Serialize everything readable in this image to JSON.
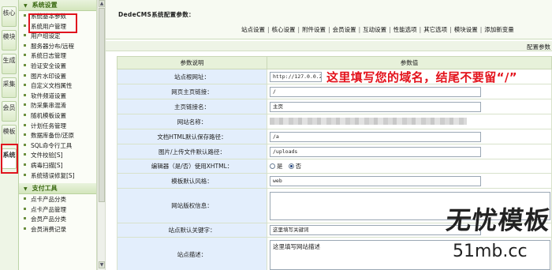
{
  "vertical_tabs": [
    {
      "label": "核心",
      "active": false
    },
    {
      "label": "模块",
      "active": false
    },
    {
      "label": "生成",
      "active": false
    },
    {
      "label": "采集",
      "active": false
    },
    {
      "label": "会员",
      "active": false
    },
    {
      "label": "模板",
      "active": false
    },
    {
      "label": "系统",
      "active": true
    }
  ],
  "menu": {
    "system_section": "系统设置",
    "system_items": [
      "系统基本参数",
      "系统用户管理",
      "用户组设定",
      "服务器分布/远程",
      "系统日志管理",
      "验证安全设置",
      "图片水印设置",
      "自定义文档属性",
      "软件频道设置",
      "防采集串混淆",
      "随机模板设置",
      "计划任务管理",
      "数据库备份/还原",
      "SQL命令行工具",
      "文件校验[S]",
      "病毒扫描[S]",
      "系统错误修复[S]"
    ],
    "pay_section": "支付工具",
    "pay_items": [
      "点卡产品分类",
      "点卡产品管理",
      "会员产品分类",
      "会员消费记录"
    ]
  },
  "header": {
    "title": "DedeCMS系统配置参数：",
    "tabs": [
      "站点设置",
      "核心设置",
      "附件设置",
      "会员设置",
      "互动设置",
      "性能选项",
      "其它选项",
      "模块设置",
      "添加新变量"
    ],
    "config_label": "配置参数"
  },
  "table": {
    "col_param": "参数说明",
    "col_value": "参数值",
    "rows": {
      "base_url_label": "站点根网址：",
      "base_url_value": "http://127.0.0.2",
      "index_link_label": "网页主页链接：",
      "index_link_value": "/",
      "index_name_label": "主页链接名：",
      "index_name_value": "主页",
      "site_name_label": "网站名称：",
      "html_path_label": "文档HTML默认保存路径：",
      "html_path_value": "/a",
      "upload_path_label": "图片/上传文件默认路径：",
      "upload_path_value": "/uploads",
      "editor_label": "编辑器（是/否）使用XHTML：",
      "editor_yes": "是",
      "editor_no": "否",
      "style_label": "模板默认风格：",
      "style_value": "web",
      "powerby_label": "网站版权信息：",
      "keywords_label": "站点默认关键字：",
      "keywords_value": "这里填写关键词",
      "description_label": "站点描述：",
      "description_value": "这里填写网站描述"
    }
  },
  "annotation": "这里填写您的域名，结尾不要留“/”",
  "watermark": {
    "logo": "无忧模板",
    "url": "51mb.cc"
  },
  "colors": {
    "annotation": "#e3121b",
    "highlight_box": "#e0141e",
    "menu_header": "#3b6a12"
  }
}
